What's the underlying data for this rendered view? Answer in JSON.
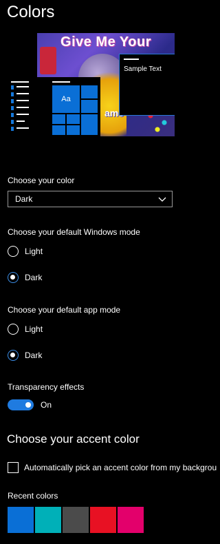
{
  "page": {
    "title": "Colors"
  },
  "preview": {
    "wallpaper_text": "Give Me Your",
    "wallpaper_text2": "ame",
    "tile_label": "Aa",
    "sample_text": "Sample Text"
  },
  "choose_color": {
    "label": "Choose your color",
    "selected": "Dark"
  },
  "windows_mode": {
    "label": "Choose your default Windows mode",
    "options": [
      "Light",
      "Dark"
    ],
    "selected": "Dark"
  },
  "app_mode": {
    "label": "Choose your default app mode",
    "options": [
      "Light",
      "Dark"
    ],
    "selected": "Dark"
  },
  "transparency": {
    "label": "Transparency effects",
    "state": "On"
  },
  "accent": {
    "title": "Choose your accent color",
    "auto_pick_label": "Automatically pick an accent color from my backgrou",
    "recent_label": "Recent colors",
    "recent_colors": [
      "#0a6fd6",
      "#00b0b8",
      "#4b4b4b",
      "#e81123",
      "#e3006b"
    ]
  },
  "colors": {
    "accent": "#1f7be0",
    "background": "#000000",
    "text": "#ffffff"
  }
}
